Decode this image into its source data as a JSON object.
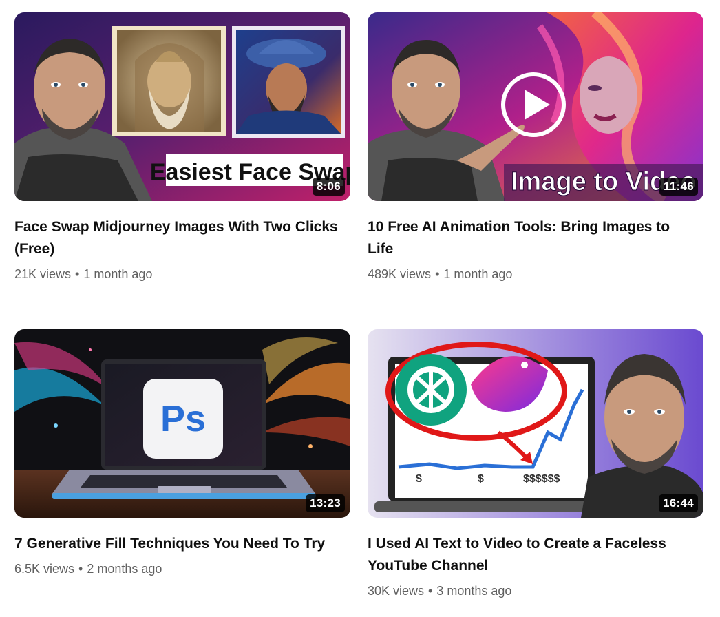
{
  "videos": [
    {
      "title": "Face Swap Midjourney Images With Two Clicks (Free)",
      "duration": "8:06",
      "views": "21K views",
      "age": "1 month ago",
      "thumb_text": "Easiest Face Swap"
    },
    {
      "title": "10 Free AI Animation Tools: Bring Images to Life",
      "duration": "11:46",
      "views": "489K views",
      "age": "1 month ago",
      "thumb_text": "Image to Video"
    },
    {
      "title": "7 Generative Fill Techniques You Need To Try",
      "duration": "13:23",
      "views": "6.5K views",
      "age": "2 months ago",
      "thumb_text": "Ps"
    },
    {
      "title": "I Used AI Text to Video to Create a Faceless YouTube Channel",
      "duration": "16:44",
      "views": "30K views",
      "age": "3 months ago",
      "thumb_text": ""
    }
  ],
  "separator": "•"
}
